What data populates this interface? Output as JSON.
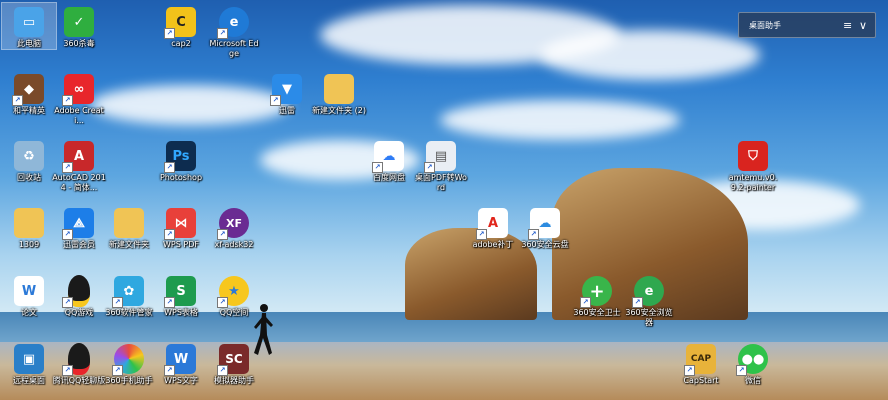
{
  "icons": [
    {
      "label": "此电脑",
      "icon": "computer-icon",
      "color": "#4aa3e8"
    },
    {
      "label": "360杀毒",
      "icon": "shield-icon",
      "color": "#2fae3f"
    },
    {
      "label": "cap2",
      "icon": "cap-app-icon",
      "color": "#f2c21a"
    },
    {
      "label": "Microsoft Edge",
      "icon": "edge-icon",
      "color": "#1f7ad6"
    },
    {
      "label": "和平精英",
      "icon": "game-icon",
      "color": "#7a4a2a"
    },
    {
      "label": "Adobe Creati...",
      "icon": "adobe-cloud-icon",
      "color": "#e8262b"
    },
    {
      "label": "迅雷",
      "icon": "thunder-icon",
      "color": "#2b8be8"
    },
    {
      "label": "新建文件夹 (2)",
      "icon": "folder-icon",
      "color": "#f0c455"
    },
    {
      "label": "回收站",
      "icon": "recycle-bin-icon",
      "color": "#8fb7d8"
    },
    {
      "label": "AutoCAD 2014 - 简体...",
      "icon": "autocad-icon",
      "color": "#c8282a"
    },
    {
      "label": "Photoshop",
      "icon": "photoshop-icon",
      "color": "#0d2c4f"
    },
    {
      "label": "百度网盘",
      "icon": "baidu-netdisk-icon",
      "color": "#2e7cf6"
    },
    {
      "label": "桌面PDF转Word",
      "icon": "document-icon",
      "color": "#e9eef4"
    },
    {
      "label": "amtemu.v0.9.2-painter",
      "icon": "amtemu-icon",
      "color": "#d9241f"
    },
    {
      "label": "1309",
      "icon": "folder-icon",
      "color": "#f0c455"
    },
    {
      "label": "迅雷会员",
      "icon": "thunder-vip-icon",
      "color": "#1d7ee8"
    },
    {
      "label": "新建文件夹",
      "icon": "folder-icon",
      "color": "#f0c455"
    },
    {
      "label": "WPS PDF",
      "icon": "wps-pdf-icon",
      "color": "#e8403a"
    },
    {
      "label": "xf-adsk32",
      "icon": "xforce-icon",
      "color": "#6a2b92"
    },
    {
      "label": "adobe补丁",
      "icon": "adobe-icon",
      "color": "#e1251b"
    },
    {
      "label": "360安全云盘",
      "icon": "cloud-drive-icon",
      "color": "#2c8be0"
    },
    {
      "label": "论文",
      "icon": "word-doc-icon",
      "color": "#ffffff"
    },
    {
      "label": "QQ游戏",
      "icon": "qq-game-icon",
      "color": "#1a1a1a"
    },
    {
      "label": "360软件管家",
      "icon": "software-manager-icon",
      "color": "#2fa8e0"
    },
    {
      "label": "WPS表格",
      "icon": "wps-sheet-icon",
      "color": "#1e9b4e"
    },
    {
      "label": "QQ空间",
      "icon": "qzone-icon",
      "color": "#f7c71e"
    },
    {
      "label": "360安全卫士",
      "icon": "plus-shield-icon",
      "color": "#39b54a"
    },
    {
      "label": "360安全浏览器",
      "icon": "browser-icon",
      "color": "#2fa84f"
    },
    {
      "label": "远程桌面",
      "icon": "remote-desktop-icon",
      "color": "#2a7fc8"
    },
    {
      "label": "腾讯QQ轻聊版",
      "icon": "qq-icon",
      "color": "#1a1a1a"
    },
    {
      "label": "360手机助手",
      "icon": "phone-assistant-icon",
      "color": "#e94b3c"
    },
    {
      "label": "WPS文字",
      "icon": "wps-writer-icon",
      "color": "#2b79d8"
    },
    {
      "label": "模拟器助手",
      "icon": "sc-icon",
      "color": "#7a2a2a"
    },
    {
      "label": "CapStart",
      "icon": "capstart-icon",
      "color": "#e8b33a"
    },
    {
      "label": "微信",
      "icon": "wechat-icon",
      "color": "#2fc24a"
    }
  ],
  "widget": {
    "title": "桌面助手",
    "menu_glyph": "≡",
    "close_glyph": "∨"
  }
}
